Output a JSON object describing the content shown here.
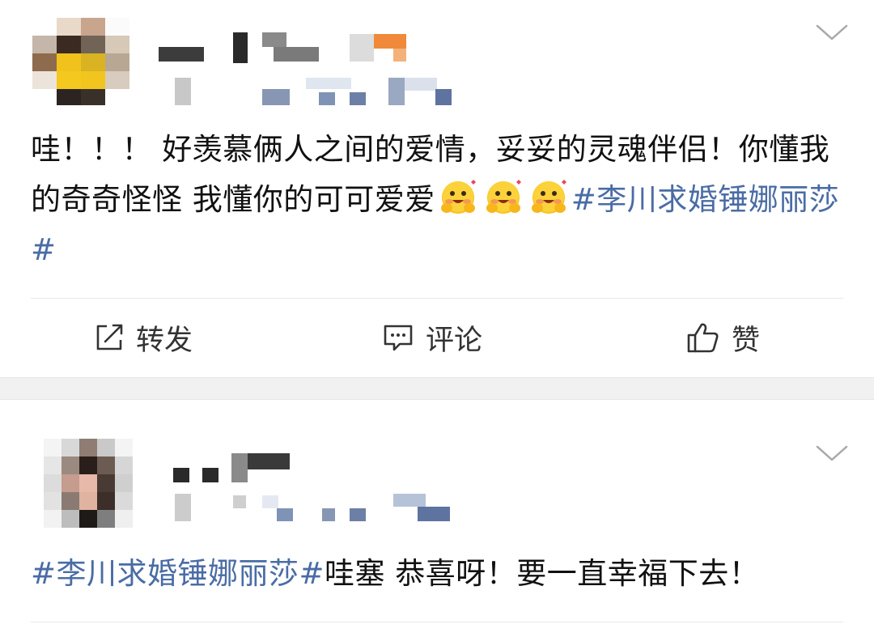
{
  "posts": [
    {
      "menu_icon": "chevron-down-icon",
      "text_prefix": "哇！！！ 好羡慕俩人之间的爱情，妥妥的灵魂伴侣！你懂我的奇奇怪怪 我懂你的可可爱爱",
      "emoji": "blushing-hugging-face",
      "emoji_count": 3,
      "hashtag": "#李川求婚锤娜丽莎#"
    },
    {
      "menu_icon": "chevron-down-icon",
      "hashtag": "#李川求婚锤娜丽莎#",
      "text_suffix": "哇塞 恭喜呀！要一直幸福下去！"
    }
  ],
  "actions": [
    {
      "label": "转发",
      "icon": "repost-icon"
    },
    {
      "label": "评论",
      "icon": "comment-icon"
    },
    {
      "label": "赞",
      "icon": "thumbs-up-icon"
    }
  ],
  "colors": {
    "hashtag": "#4a6ca5",
    "text": "#111111",
    "separator": "#f1f1f1"
  }
}
